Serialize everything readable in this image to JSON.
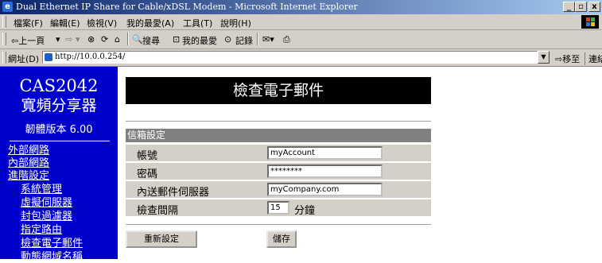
{
  "window": {
    "title": "Dual Ethernet IP Share for Cable/xDSL Modem - Microsoft Internet Explorer",
    "minimize": "_",
    "restore": "▫",
    "close": "x"
  },
  "menu": [
    "檔案(F)",
    "編輯(E)",
    "檢視(V)",
    "我的最愛(A)",
    "工具(T)",
    "說明(H)"
  ],
  "toolbar": {
    "back": "⇦上一頁",
    "back_arrow": "▾",
    "forward": "⇨",
    "forward_arrow": "▾",
    "stop": "⊗",
    "refresh": "⟳",
    "home": "⌂",
    "search": "搜尋",
    "favorites": "我的最愛",
    "history": "記錄",
    "mail": "✉▾",
    "print": "⎙"
  },
  "address": {
    "label": "網址(D)",
    "url": "http://10.0.0.254/",
    "go": "移至",
    "links": "連結 »"
  },
  "sidebar": {
    "product": "CAS2042",
    "product_name": "寬頻分享器",
    "firmware": "韌體版本 6.00",
    "links": [
      "外部網路",
      "內部網路",
      "進階設定",
      "系統管理",
      "虛擬伺服器",
      "封包過濾器",
      "指定路由",
      "檢查電子郵件",
      "動態網域名稱"
    ]
  },
  "page": {
    "title": "檢查電子郵件",
    "section": "信箱設定",
    "fields": [
      {
        "label": "帳號",
        "value": "myAccount"
      },
      {
        "label": "密碼",
        "value": "********"
      },
      {
        "label": "內送郵件伺服器",
        "value": "myCompany.com"
      },
      {
        "label": "檢查間隔",
        "value": "15",
        "unit": "分鐘"
      }
    ],
    "reset_button": "重新設定",
    "save_button": "儲存"
  }
}
